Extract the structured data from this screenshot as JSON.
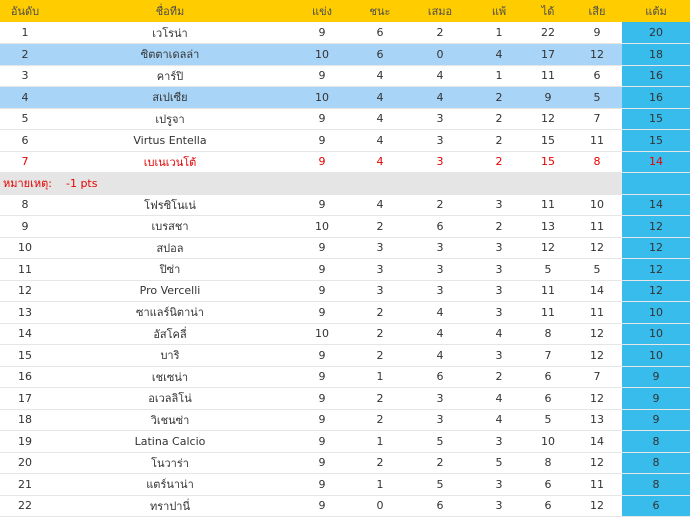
{
  "headers": {
    "rank": "อันดับ",
    "team": "ชื่อทีม",
    "played": "แข่ง",
    "won": "ชนะ",
    "drawn": "เสมอ",
    "lost": "แพ้",
    "goals_for": "ได้",
    "goals_against": "เสีย",
    "points": "แต้ม"
  },
  "note": {
    "label": "หมายเหตุ:",
    "text": "-1 pts"
  },
  "rows_top": [
    {
      "rank": "1",
      "team": "เวโรน่า",
      "played": "9",
      "won": "6",
      "drawn": "2",
      "lost": "1",
      "gf": "22",
      "ga": "9",
      "pts": "20"
    },
    {
      "rank": "2",
      "team": "ซิตตาเดลล่า",
      "played": "10",
      "won": "6",
      "drawn": "0",
      "lost": "4",
      "gf": "17",
      "ga": "12",
      "pts": "18"
    },
    {
      "rank": "3",
      "team": "คาร์ปิ",
      "played": "9",
      "won": "4",
      "drawn": "4",
      "lost": "1",
      "gf": "11",
      "ga": "6",
      "pts": "16"
    },
    {
      "rank": "4",
      "team": "สเปเซีย",
      "played": "10",
      "won": "4",
      "drawn": "4",
      "lost": "2",
      "gf": "9",
      "ga": "5",
      "pts": "16"
    },
    {
      "rank": "5",
      "team": "เปรูจา",
      "played": "9",
      "won": "4",
      "drawn": "3",
      "lost": "2",
      "gf": "12",
      "ga": "7",
      "pts": "15"
    },
    {
      "rank": "6",
      "team": "Virtus Entella",
      "played": "9",
      "won": "4",
      "drawn": "3",
      "lost": "2",
      "gf": "15",
      "ga": "11",
      "pts": "15"
    },
    {
      "rank": "7",
      "team": "เบเนเวนโต้",
      "played": "9",
      "won": "4",
      "drawn": "3",
      "lost": "2",
      "gf": "15",
      "ga": "8",
      "pts": "14"
    }
  ],
  "rows_bottom": [
    {
      "rank": "8",
      "team": "โฟรซิโนเน่",
      "played": "9",
      "won": "4",
      "drawn": "2",
      "lost": "3",
      "gf": "11",
      "ga": "10",
      "pts": "14"
    },
    {
      "rank": "9",
      "team": "เบรสชา",
      "played": "10",
      "won": "2",
      "drawn": "6",
      "lost": "2",
      "gf": "13",
      "ga": "11",
      "pts": "12"
    },
    {
      "rank": "10",
      "team": "สปอล",
      "played": "9",
      "won": "3",
      "drawn": "3",
      "lost": "3",
      "gf": "12",
      "ga": "12",
      "pts": "12"
    },
    {
      "rank": "11",
      "team": "ปิซ่า",
      "played": "9",
      "won": "3",
      "drawn": "3",
      "lost": "3",
      "gf": "5",
      "ga": "5",
      "pts": "12"
    },
    {
      "rank": "12",
      "team": "Pro Vercelli",
      "played": "9",
      "won": "3",
      "drawn": "3",
      "lost": "3",
      "gf": "11",
      "ga": "14",
      "pts": "12"
    },
    {
      "rank": "13",
      "team": "ซาแลร์นิตาน่า",
      "played": "9",
      "won": "2",
      "drawn": "4",
      "lost": "3",
      "gf": "11",
      "ga": "11",
      "pts": "10"
    },
    {
      "rank": "14",
      "team": "อัสโคลี่",
      "played": "10",
      "won": "2",
      "drawn": "4",
      "lost": "4",
      "gf": "8",
      "ga": "12",
      "pts": "10"
    },
    {
      "rank": "15",
      "team": "บาริ",
      "played": "9",
      "won": "2",
      "drawn": "4",
      "lost": "3",
      "gf": "7",
      "ga": "12",
      "pts": "10"
    },
    {
      "rank": "16",
      "team": "เชเซน่า",
      "played": "9",
      "won": "1",
      "drawn": "6",
      "lost": "2",
      "gf": "6",
      "ga": "7",
      "pts": "9"
    },
    {
      "rank": "17",
      "team": "อเวลลิโน่",
      "played": "9",
      "won": "2",
      "drawn": "3",
      "lost": "4",
      "gf": "6",
      "ga": "12",
      "pts": "9"
    },
    {
      "rank": "18",
      "team": "วิเชนซ่า",
      "played": "9",
      "won": "2",
      "drawn": "3",
      "lost": "4",
      "gf": "5",
      "ga": "13",
      "pts": "9"
    },
    {
      "rank": "19",
      "team": "Latina Calcio",
      "played": "9",
      "won": "1",
      "drawn": "5",
      "lost": "3",
      "gf": "10",
      "ga": "14",
      "pts": "8"
    },
    {
      "rank": "20",
      "team": "โนวาร่า",
      "played": "9",
      "won": "2",
      "drawn": "2",
      "lost": "5",
      "gf": "8",
      "ga": "12",
      "pts": "8"
    },
    {
      "rank": "21",
      "team": "แตร์นาน่า",
      "played": "9",
      "won": "1",
      "drawn": "5",
      "lost": "3",
      "gf": "6",
      "ga": "11",
      "pts": "8"
    },
    {
      "rank": "22",
      "team": "ทราปานี่",
      "played": "9",
      "won": "0",
      "drawn": "6",
      "lost": "3",
      "gf": "6",
      "ga": "12",
      "pts": "6"
    }
  ],
  "colors": {
    "header_bg": "#ffcc00",
    "highlight_row": "#a8d4f7",
    "points_col": "#38bcec",
    "penalty_text": "#e60000",
    "note_bg": "#e5e5e5"
  }
}
